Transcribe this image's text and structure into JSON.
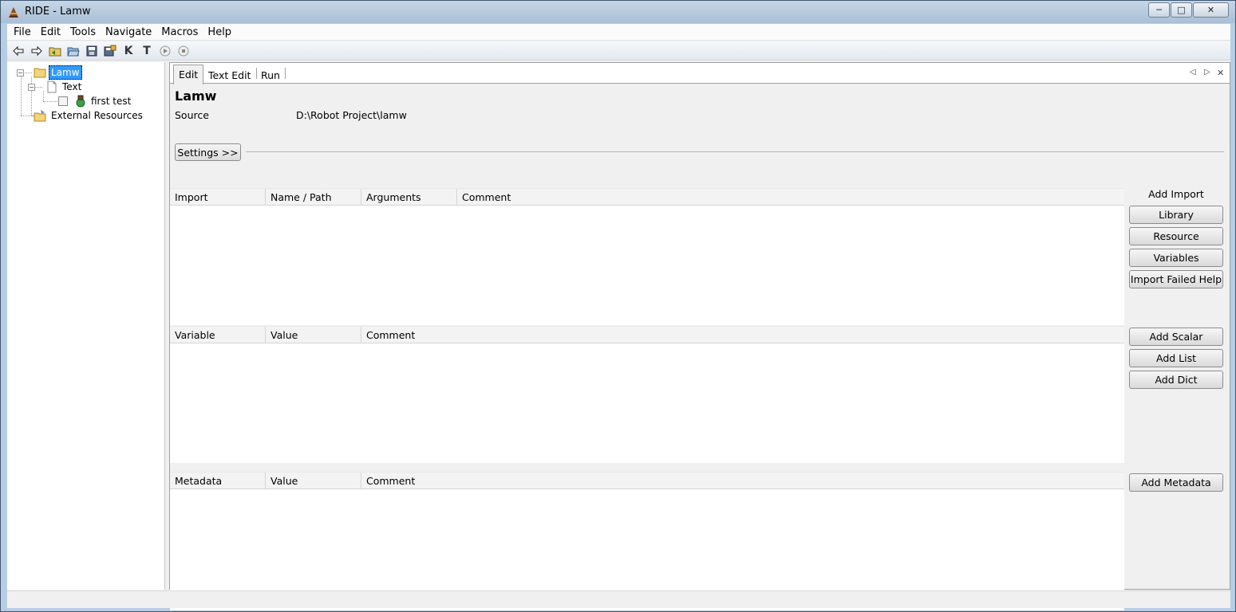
{
  "window": {
    "title": "RIDE - Lamw",
    "minimize": "─",
    "maximize": "□",
    "close": "✕"
  },
  "menu": {
    "items": [
      "File",
      "Edit",
      "Tools",
      "Navigate",
      "Macros",
      "Help"
    ]
  },
  "toolbar": {
    "buttons": [
      "back-icon",
      "forward-icon",
      "open-directory-icon",
      "open-folder-icon",
      "save-icon",
      "save-all-icon",
      "keyword-search-icon",
      "test-search-icon",
      "run-icon",
      "stop-icon"
    ],
    "keyword_glyph": "K",
    "test_glyph": "T"
  },
  "tree": {
    "root": "Lamw",
    "suite": "Text",
    "test": "first test",
    "external": "External Resources"
  },
  "tabs": {
    "items": [
      "Edit",
      "Text Edit",
      "Run"
    ],
    "active": "Edit",
    "prev": "◁",
    "next": "▷",
    "close": "✕"
  },
  "editor": {
    "title": "Lamw",
    "source_label": "Source",
    "source_value": "D:\\Robot Project\\lamw",
    "settings_button": "Settings >>"
  },
  "imports": {
    "headers": [
      "Import",
      "Name / Path",
      "Arguments",
      "Comment"
    ],
    "side_label": "Add Import",
    "buttons": [
      "Library",
      "Resource",
      "Variables",
      "Import Failed Help"
    ]
  },
  "variables": {
    "headers": [
      "Variable",
      "Value",
      "Comment"
    ],
    "buttons": [
      "Add Scalar",
      "Add List",
      "Add Dict"
    ]
  },
  "metadata": {
    "headers": [
      "Metadata",
      "Value",
      "Comment"
    ],
    "buttons": [
      "Add Metadata"
    ]
  }
}
